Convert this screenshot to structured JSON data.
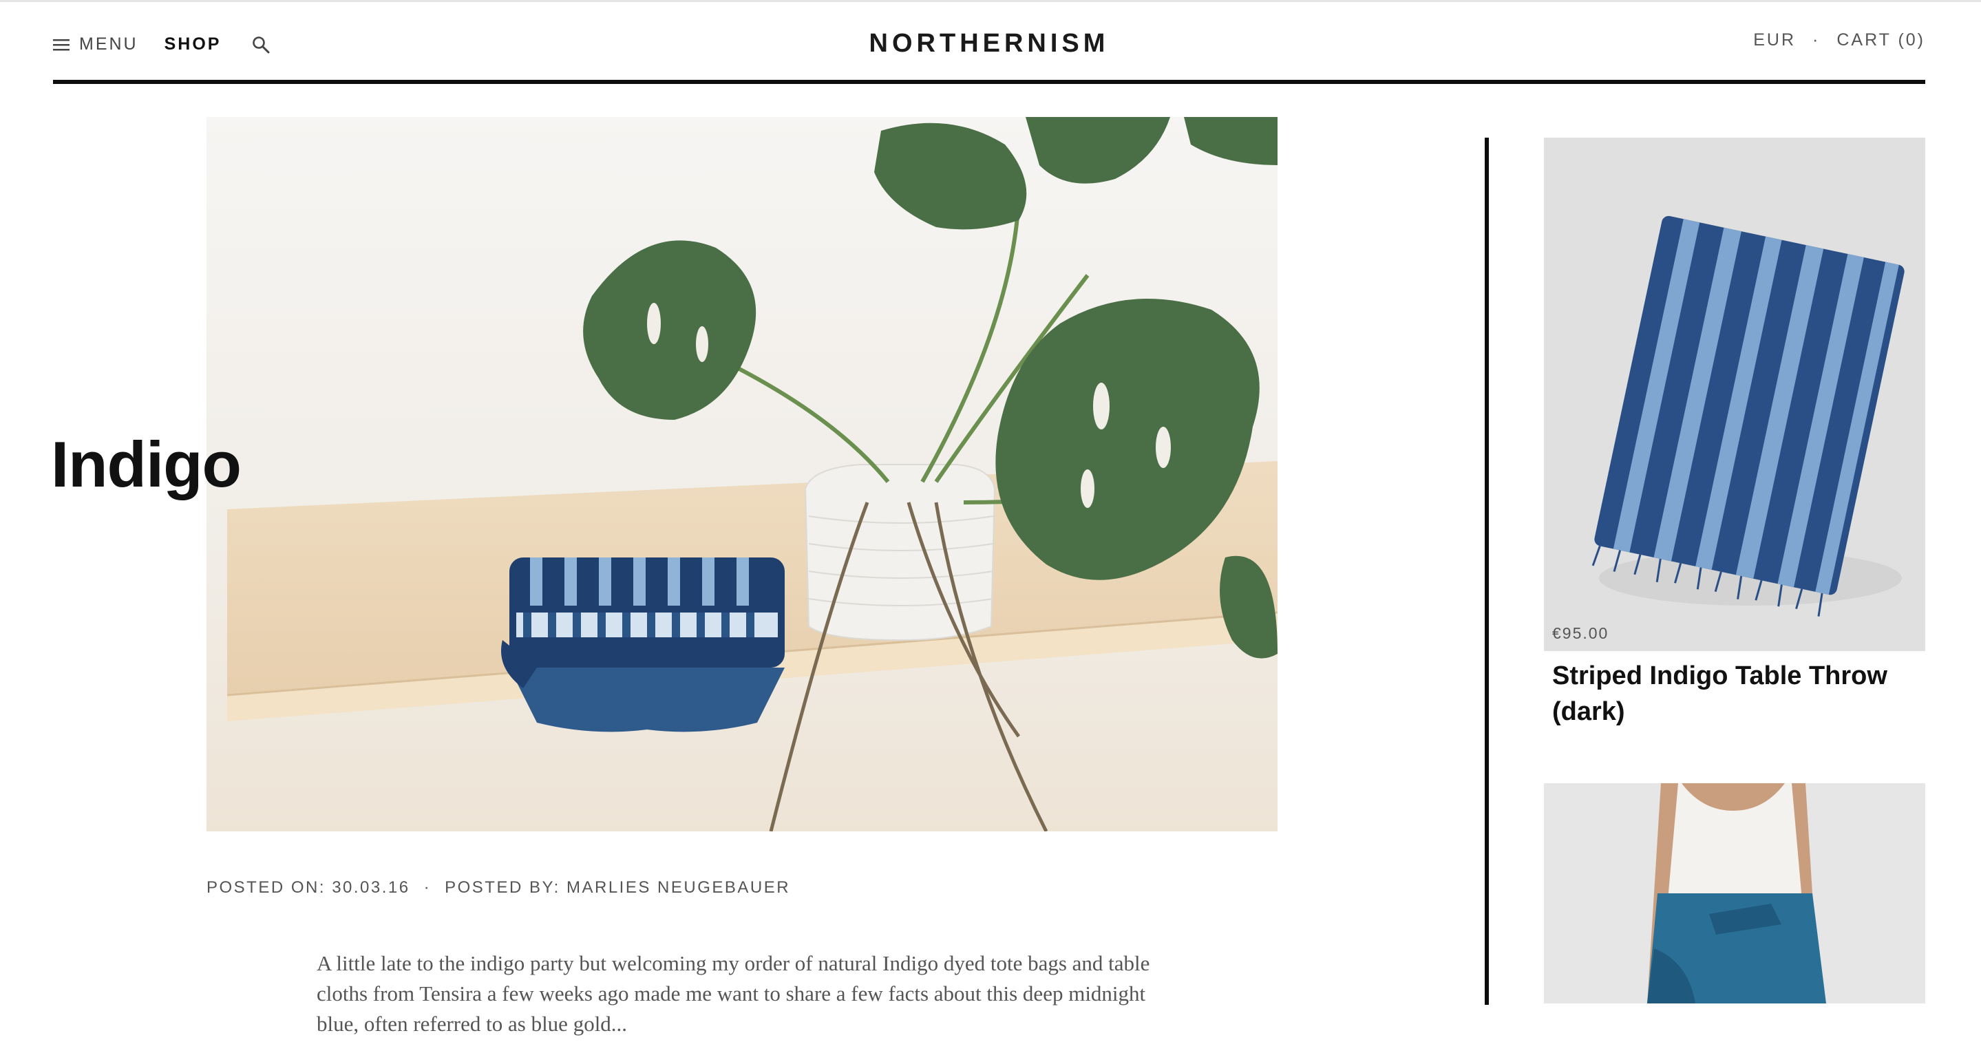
{
  "header": {
    "menu_label": "MENU",
    "shop_label": "SHOP",
    "brand": "NORTHERNISM",
    "currency": "EUR",
    "separator": "·",
    "cart_label": "CART (0)"
  },
  "post": {
    "title": "Indigo",
    "posted_on": "POSTED ON: 30.03.16",
    "meta_separator": "·",
    "posted_by": "POSTED BY: MARLIES NEUGEBAUER",
    "excerpt": "A little late to the indigo party but welcoming my order of natural Indigo dyed tote bags and table cloths from Tensira a few weeks ago made me want to share a few facts about this deep midnight blue, often referred to as blue gold..."
  },
  "sidebar": {
    "products": [
      {
        "price": "€95.00",
        "title": "Striped Indigo Table Throw (dark)"
      }
    ]
  },
  "colors": {
    "accent": "#0d0d0d",
    "indigo": "#2f5c8f"
  },
  "icons": [
    "hamburger-icon",
    "search-icon"
  ]
}
